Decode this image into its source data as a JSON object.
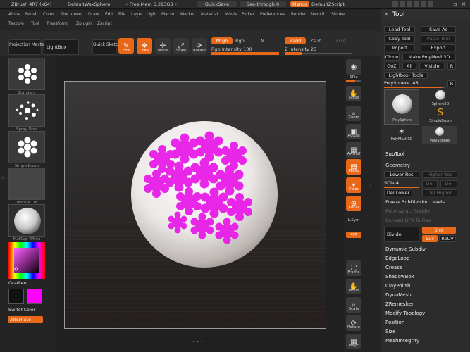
{
  "titlebar": {
    "app": "ZBrush 4R7 (x64)",
    "document": "DefaultWaxSphere",
    "free_mem": "• Free Mem 6.293GB •",
    "quicksave": "QuickSave",
    "see_through": "See-through  0",
    "menus": "Menus",
    "script": "DefaultZScript"
  },
  "menus": {
    "row1": [
      "Alpha",
      "Brush",
      "Color",
      "Document",
      "Draw",
      "Edit",
      "File",
      "Layer",
      "Light",
      "Macro",
      "Marker",
      "Material",
      "Movie",
      "Picker",
      "Preferences",
      "Render",
      "Stencil",
      "Stroke"
    ],
    "row2": [
      "Texture",
      "Tool",
      "Transform",
      "Zplugin",
      "Zscript"
    ]
  },
  "shelf": {
    "projection_master": "Projection Master",
    "lightbox": "LightBox",
    "quick_sketch": "Quick Sketch",
    "edit": "Edit",
    "draw": "Draw",
    "move": "Move",
    "scale": "Scale",
    "rotate": "Rotate",
    "mrgb": "Mrgb",
    "rgb": "Rgb",
    "m": "M",
    "zadd": "Zadd",
    "zsub": "Zsub",
    "zcut": "Zcut",
    "rgb_intensity": "Rgb Intensity 100",
    "rgb_intensity_value": 100,
    "z_intensity": "Z Intensity 25",
    "z_intensity_value": 25
  },
  "leftbar": {
    "thumbs": [
      "Standard",
      "Spray Dots",
      "SimpleBrush",
      "Texture Off",
      "MatCap White"
    ],
    "gradient": "Gradient",
    "switch_color": "SwitchColor",
    "alternate": "Alternate"
  },
  "rightbar": {
    "spix_label": "SPix",
    "spix_value": "3",
    "buttons": [
      "Scroll",
      "Zoom",
      "Actual",
      "AAHalf",
      "Persp",
      "Floor",
      "Local",
      "L.Sym",
      "xyz",
      "Frame",
      "Move",
      "Scale",
      "Rotate",
      "PolyF"
    ]
  },
  "palette": {
    "title": "Tool",
    "load_tool": "Load Tool",
    "save_as": "Save As",
    "copy_tool": "Copy Tool",
    "paste_tool": "Paste Tool",
    "import": "Import",
    "export": "Export",
    "clone": "Clone",
    "make_polymesh": "Make PolyMesh3D",
    "goz": "GoZ",
    "all": "All",
    "visible": "Visible",
    "r": "R",
    "lightbox_tools": "Lightbox› Tools",
    "current_tool": "PolySphere. 48",
    "tools": [
      "PolySphere",
      "Sphere3D",
      "SimpleBrush",
      "PolyMesh3D",
      "PolySphere"
    ],
    "subtool": "SubTool",
    "geometry": "Geometry",
    "lower_res": "Lower Res",
    "higher_res": "Higher Res",
    "sdiv": "SDiv 4",
    "del": "Del",
    "del_lower": "Del Lower",
    "del_higher": "Del Higher",
    "freeze": "Freeze SubDivision Levels",
    "reconstruct": "Reconstruct Subdiv",
    "convert_bpr": "Convert BPR To Geo",
    "divide": "Divide",
    "smt": "Smt",
    "suv": "Suv",
    "reuv": "ReUV",
    "sections": [
      "Dynamic Subdiv",
      "EdgeLoop",
      "Crease",
      "ShadowBox",
      "ClayPolish",
      "DynaMesh",
      "ZRemesher",
      "Modify Topology",
      "Position",
      "Size",
      "MeshIntegrity"
    ]
  },
  "colors": {
    "accent": "#e8681a",
    "main_color": "#111111",
    "secondary_color": "#ff00ff"
  }
}
